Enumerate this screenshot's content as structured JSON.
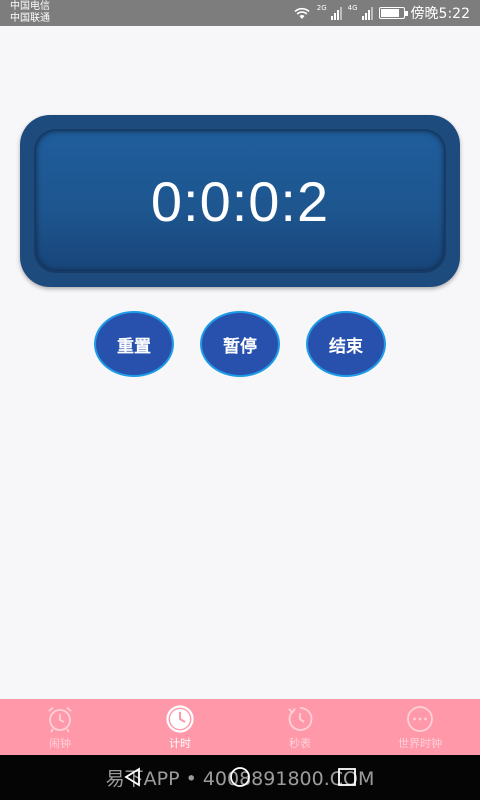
{
  "status_bar": {
    "carrier_1": "中国电信",
    "carrier_2": "中国联通",
    "net_1": "2G",
    "net_2": "4G",
    "time": "傍晚5:22",
    "battery_level": 0.85
  },
  "timer": {
    "display": "0:0:0:2"
  },
  "controls": {
    "reset_label": "重置",
    "pause_label": "暂停",
    "end_label": "结束"
  },
  "tabs": [
    {
      "label": "闹钟",
      "icon": "alarm-clock-icon",
      "active": false
    },
    {
      "label": "计时",
      "icon": "clock-icon",
      "active": true
    },
    {
      "label": "秒表",
      "icon": "stopwatch-icon",
      "active": false
    },
    {
      "label": "世界时钟",
      "icon": "world-clock-icon",
      "active": false
    }
  ],
  "watermark": "易下APP • 4008891800.COM",
  "colors": {
    "tab_bar": "#ff99aa",
    "timer_bg": "#1e4b7e",
    "button_bg": "#2851ae",
    "button_border": "#1e9ae6"
  }
}
